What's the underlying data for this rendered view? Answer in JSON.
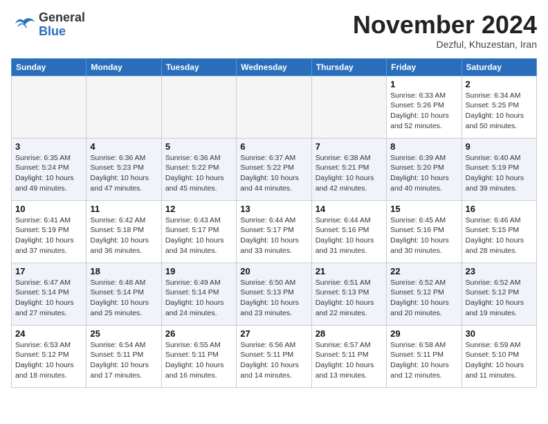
{
  "header": {
    "logo_line1": "General",
    "logo_line2": "Blue",
    "month": "November 2024",
    "location": "Dezful, Khuzestan, Iran"
  },
  "weekdays": [
    "Sunday",
    "Monday",
    "Tuesday",
    "Wednesday",
    "Thursday",
    "Friday",
    "Saturday"
  ],
  "weeks": [
    {
      "shaded": false,
      "days": [
        {
          "num": "",
          "info": ""
        },
        {
          "num": "",
          "info": ""
        },
        {
          "num": "",
          "info": ""
        },
        {
          "num": "",
          "info": ""
        },
        {
          "num": "",
          "info": ""
        },
        {
          "num": "1",
          "info": "Sunrise: 6:33 AM\nSunset: 5:26 PM\nDaylight: 10 hours\nand 52 minutes."
        },
        {
          "num": "2",
          "info": "Sunrise: 6:34 AM\nSunset: 5:25 PM\nDaylight: 10 hours\nand 50 minutes."
        }
      ]
    },
    {
      "shaded": true,
      "days": [
        {
          "num": "3",
          "info": "Sunrise: 6:35 AM\nSunset: 5:24 PM\nDaylight: 10 hours\nand 49 minutes."
        },
        {
          "num": "4",
          "info": "Sunrise: 6:36 AM\nSunset: 5:23 PM\nDaylight: 10 hours\nand 47 minutes."
        },
        {
          "num": "5",
          "info": "Sunrise: 6:36 AM\nSunset: 5:22 PM\nDaylight: 10 hours\nand 45 minutes."
        },
        {
          "num": "6",
          "info": "Sunrise: 6:37 AM\nSunset: 5:22 PM\nDaylight: 10 hours\nand 44 minutes."
        },
        {
          "num": "7",
          "info": "Sunrise: 6:38 AM\nSunset: 5:21 PM\nDaylight: 10 hours\nand 42 minutes."
        },
        {
          "num": "8",
          "info": "Sunrise: 6:39 AM\nSunset: 5:20 PM\nDaylight: 10 hours\nand 40 minutes."
        },
        {
          "num": "9",
          "info": "Sunrise: 6:40 AM\nSunset: 5:19 PM\nDaylight: 10 hours\nand 39 minutes."
        }
      ]
    },
    {
      "shaded": false,
      "days": [
        {
          "num": "10",
          "info": "Sunrise: 6:41 AM\nSunset: 5:19 PM\nDaylight: 10 hours\nand 37 minutes."
        },
        {
          "num": "11",
          "info": "Sunrise: 6:42 AM\nSunset: 5:18 PM\nDaylight: 10 hours\nand 36 minutes."
        },
        {
          "num": "12",
          "info": "Sunrise: 6:43 AM\nSunset: 5:17 PM\nDaylight: 10 hours\nand 34 minutes."
        },
        {
          "num": "13",
          "info": "Sunrise: 6:44 AM\nSunset: 5:17 PM\nDaylight: 10 hours\nand 33 minutes."
        },
        {
          "num": "14",
          "info": "Sunrise: 6:44 AM\nSunset: 5:16 PM\nDaylight: 10 hours\nand 31 minutes."
        },
        {
          "num": "15",
          "info": "Sunrise: 6:45 AM\nSunset: 5:16 PM\nDaylight: 10 hours\nand 30 minutes."
        },
        {
          "num": "16",
          "info": "Sunrise: 6:46 AM\nSunset: 5:15 PM\nDaylight: 10 hours\nand 28 minutes."
        }
      ]
    },
    {
      "shaded": true,
      "days": [
        {
          "num": "17",
          "info": "Sunrise: 6:47 AM\nSunset: 5:14 PM\nDaylight: 10 hours\nand 27 minutes."
        },
        {
          "num": "18",
          "info": "Sunrise: 6:48 AM\nSunset: 5:14 PM\nDaylight: 10 hours\nand 25 minutes."
        },
        {
          "num": "19",
          "info": "Sunrise: 6:49 AM\nSunset: 5:14 PM\nDaylight: 10 hours\nand 24 minutes."
        },
        {
          "num": "20",
          "info": "Sunrise: 6:50 AM\nSunset: 5:13 PM\nDaylight: 10 hours\nand 23 minutes."
        },
        {
          "num": "21",
          "info": "Sunrise: 6:51 AM\nSunset: 5:13 PM\nDaylight: 10 hours\nand 22 minutes."
        },
        {
          "num": "22",
          "info": "Sunrise: 6:52 AM\nSunset: 5:12 PM\nDaylight: 10 hours\nand 20 minutes."
        },
        {
          "num": "23",
          "info": "Sunrise: 6:52 AM\nSunset: 5:12 PM\nDaylight: 10 hours\nand 19 minutes."
        }
      ]
    },
    {
      "shaded": false,
      "days": [
        {
          "num": "24",
          "info": "Sunrise: 6:53 AM\nSunset: 5:12 PM\nDaylight: 10 hours\nand 18 minutes."
        },
        {
          "num": "25",
          "info": "Sunrise: 6:54 AM\nSunset: 5:11 PM\nDaylight: 10 hours\nand 17 minutes."
        },
        {
          "num": "26",
          "info": "Sunrise: 6:55 AM\nSunset: 5:11 PM\nDaylight: 10 hours\nand 16 minutes."
        },
        {
          "num": "27",
          "info": "Sunrise: 6:56 AM\nSunset: 5:11 PM\nDaylight: 10 hours\nand 14 minutes."
        },
        {
          "num": "28",
          "info": "Sunrise: 6:57 AM\nSunset: 5:11 PM\nDaylight: 10 hours\nand 13 minutes."
        },
        {
          "num": "29",
          "info": "Sunrise: 6:58 AM\nSunset: 5:11 PM\nDaylight: 10 hours\nand 12 minutes."
        },
        {
          "num": "30",
          "info": "Sunrise: 6:59 AM\nSunset: 5:10 PM\nDaylight: 10 hours\nand 11 minutes."
        }
      ]
    }
  ]
}
